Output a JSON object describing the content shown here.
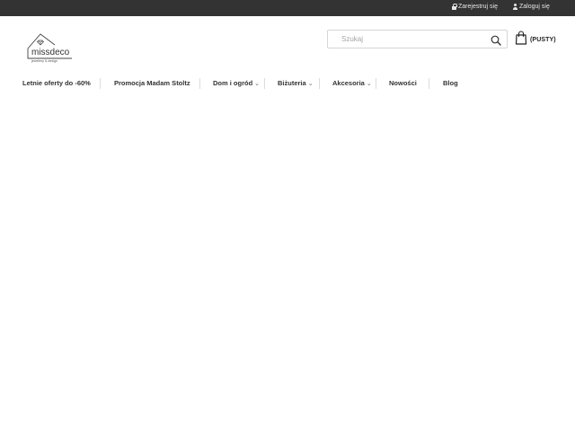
{
  "topbar": {
    "register_label": "Zarejestruj się",
    "login_label": "Zaloguj się",
    "background": "#333333"
  },
  "logo": {
    "name": "missdeco",
    "tagline": "jewellery & design"
  },
  "search": {
    "placeholder": "Szukaj",
    "value": ""
  },
  "cart": {
    "label": "(PUSTY)"
  },
  "nav": {
    "items": [
      {
        "label": "Letnie oferty do -60%"
      },
      {
        "label": "Promocja Madam Stoltz"
      },
      {
        "label": "Dom i ogród",
        "dropdown": "chevron-down"
      },
      {
        "label": "Biżuteria",
        "dropdown": "chevron-down"
      },
      {
        "label": "Akcesoria",
        "dropdown": "chevron-down"
      },
      {
        "label": "Nowości"
      },
      {
        "label": "Blog"
      }
    ]
  }
}
